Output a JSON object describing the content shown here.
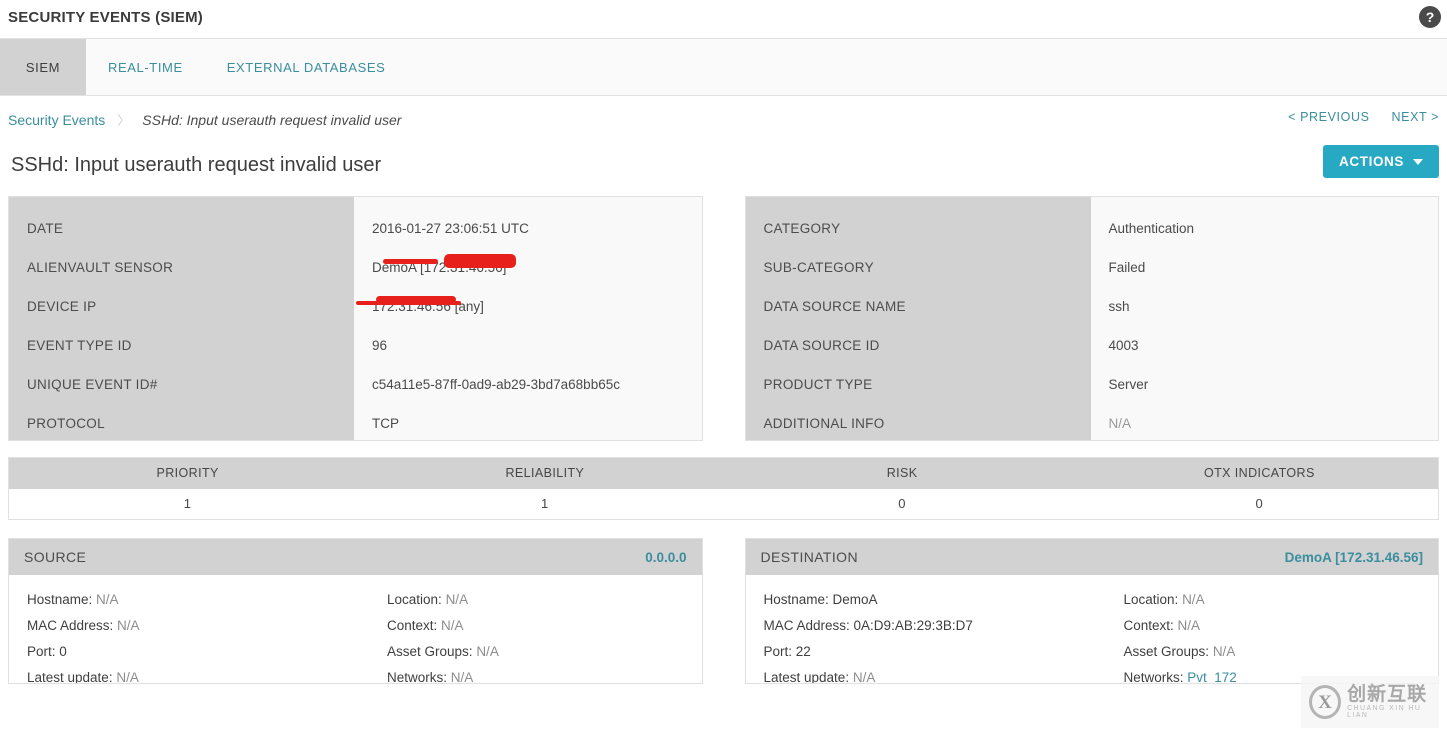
{
  "header": {
    "app_title": "SECURITY EVENTS (SIEM)",
    "help_icon_label": "?"
  },
  "tabs": [
    {
      "label": "SIEM",
      "active": true
    },
    {
      "label": "REAL-TIME",
      "active": false
    },
    {
      "label": "EXTERNAL DATABASES",
      "active": false
    }
  ],
  "breadcrumb": {
    "root": "Security Events",
    "separator": "〉",
    "current": "SSHd: Input userauth request invalid user"
  },
  "pager": {
    "previous": "< PREVIOUS",
    "next": "NEXT >"
  },
  "title_row": {
    "page_title": "SSHd: Input userauth request invalid user",
    "actions_label": "ACTIONS"
  },
  "details_left": [
    {
      "label": "DATE",
      "value": "2016-01-27 23:06:51 UTC",
      "redacted": false
    },
    {
      "label": "ALIENVAULT SENSOR",
      "value": "DemoA [172.31.46.56]",
      "redacted": true
    },
    {
      "label": "DEVICE IP",
      "value": "172.31.46.56 [any]",
      "redacted": true
    },
    {
      "label": "EVENT TYPE ID",
      "value": "96",
      "redacted": false
    },
    {
      "label": "UNIQUE EVENT ID#",
      "value": "c54a11e5-87ff-0ad9-ab29-3bd7a68bb65c",
      "redacted": false
    },
    {
      "label": "PROTOCOL",
      "value": "TCP",
      "redacted": false
    }
  ],
  "details_right": [
    {
      "label": "CATEGORY",
      "value": "Authentication",
      "muted": false
    },
    {
      "label": "SUB-CATEGORY",
      "value": "Failed",
      "muted": false
    },
    {
      "label": "DATA SOURCE NAME",
      "value": "ssh",
      "muted": false
    },
    {
      "label": "DATA SOURCE ID",
      "value": "4003",
      "muted": false
    },
    {
      "label": "PRODUCT TYPE",
      "value": "Server",
      "muted": false
    },
    {
      "label": "ADDITIONAL INFO",
      "value": "N/A",
      "muted": true
    }
  ],
  "metrics": {
    "columns": [
      "PRIORITY",
      "RELIABILITY",
      "RISK",
      "OTX INDICATORS"
    ],
    "values": [
      "1",
      "1",
      "0",
      "0"
    ]
  },
  "source": {
    "title": "SOURCE",
    "address": "0.0.0.0",
    "left_fields": [
      {
        "label": "Hostname:",
        "value": "N/A",
        "style": "muted"
      },
      {
        "label": "MAC Address:",
        "value": "N/A",
        "style": "muted"
      },
      {
        "label": "Port:",
        "value": "0",
        "style": "dark"
      },
      {
        "label": "Latest update:",
        "value": "N/A",
        "style": "muted"
      }
    ],
    "right_fields": [
      {
        "label": "Location:",
        "value": "N/A",
        "style": "muted"
      },
      {
        "label": "Context:",
        "value": "N/A",
        "style": "muted"
      },
      {
        "label": "Asset Groups:",
        "value": "N/A",
        "style": "muted"
      },
      {
        "label": "Networks:",
        "value": "N/A",
        "style": "muted"
      }
    ]
  },
  "destination": {
    "title": "DESTINATION",
    "address": "DemoA [172.31.46.56]",
    "left_fields": [
      {
        "label": "Hostname:",
        "value": "DemoA",
        "style": "dark"
      },
      {
        "label": "MAC Address:",
        "value": "0A:D9:AB:29:3B:D7",
        "style": "dark"
      },
      {
        "label": "Port:",
        "value": "22",
        "style": "dark"
      },
      {
        "label": "Latest update:",
        "value": "N/A",
        "style": "muted"
      }
    ],
    "right_fields": [
      {
        "label": "Location:",
        "value": "N/A",
        "style": "muted"
      },
      {
        "label": "Context:",
        "value": "N/A",
        "style": "muted"
      },
      {
        "label": "Asset Groups:",
        "value": "N/A",
        "style": "muted"
      },
      {
        "label": "Networks:",
        "value": "Pvt_172",
        "style": "link"
      }
    ]
  },
  "watermark": {
    "logo": "X",
    "chinese": "创新互联",
    "pinyin": "CHUANG XIN HU LIAN"
  },
  "colors": {
    "accent": "#27a9c3",
    "link": "#3a8e9e",
    "panel_label_bg": "#d2d2d2",
    "redaction": "#e8201c"
  }
}
